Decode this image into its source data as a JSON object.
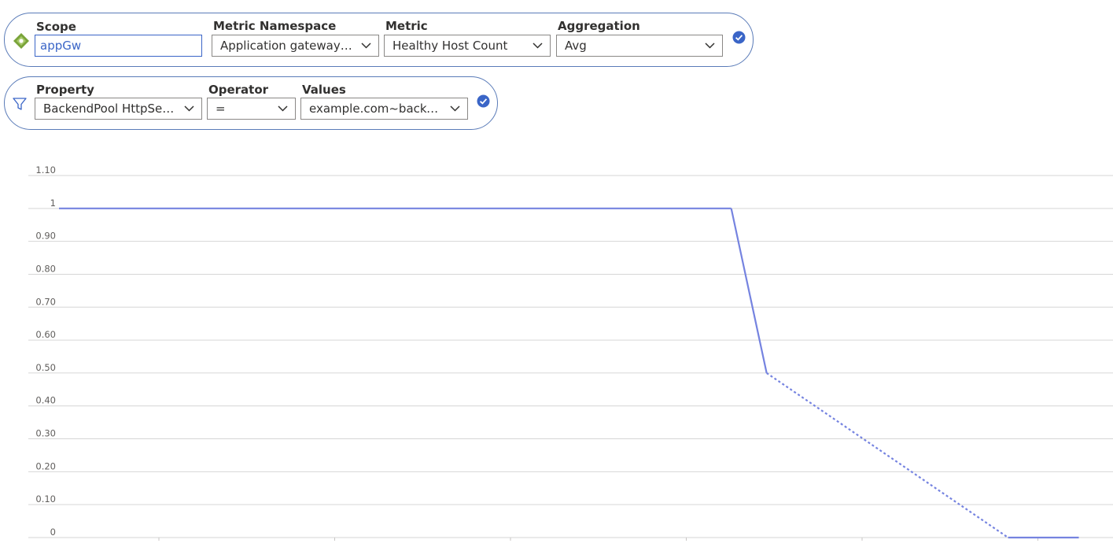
{
  "scope_row": {
    "scope_label": "Scope",
    "scope_value": "appGw",
    "namespace_label": "Metric Namespace",
    "namespace_value": "Application gateway s...",
    "metric_label": "Metric",
    "metric_value": "Healthy Host Count",
    "aggregation_label": "Aggregation",
    "aggregation_value": "Avg"
  },
  "filter_row": {
    "property_label": "Property",
    "property_value": "BackendPool HttpSett...",
    "operator_label": "Operator",
    "operator_value": "=",
    "values_label": "Values",
    "values_value": "example.com~backen..."
  },
  "icons": {
    "scope_icon": "resource-diamond-icon",
    "filter_icon": "funnel-filter-icon",
    "confirm_icon": "check-circle-icon",
    "dropdown_icon": "chevron-down-icon"
  },
  "colors": {
    "accent": "#3a65c7",
    "series": "#7583e0",
    "gridline": "#d6d6d6",
    "pill_border": "#5a7bb8",
    "scope_icon_green": "#7aa43a"
  },
  "chart_data": {
    "type": "line",
    "ylim": [
      0,
      1.1
    ],
    "yticks": [
      "1.10",
      "1",
      "0.90",
      "0.80",
      "0.70",
      "0.60",
      "0.50",
      "0.40",
      "0.30",
      "0.20",
      "0.10",
      "0"
    ],
    "ytick_values": [
      1.1,
      1,
      0.9,
      0.8,
      0.7,
      0.6,
      0.5,
      0.4,
      0.3,
      0.2,
      0.1,
      0
    ],
    "x_ticks_count": 6,
    "grid": true,
    "series": [
      {
        "values": [
          1,
          1,
          0.5,
          0,
          0
        ],
        "x": [
          0.0,
          0.646,
          0.68,
          0.912,
          0.98
        ],
        "segments": [
          "solid",
          "solid",
          "dashed",
          "solid"
        ]
      }
    ]
  }
}
